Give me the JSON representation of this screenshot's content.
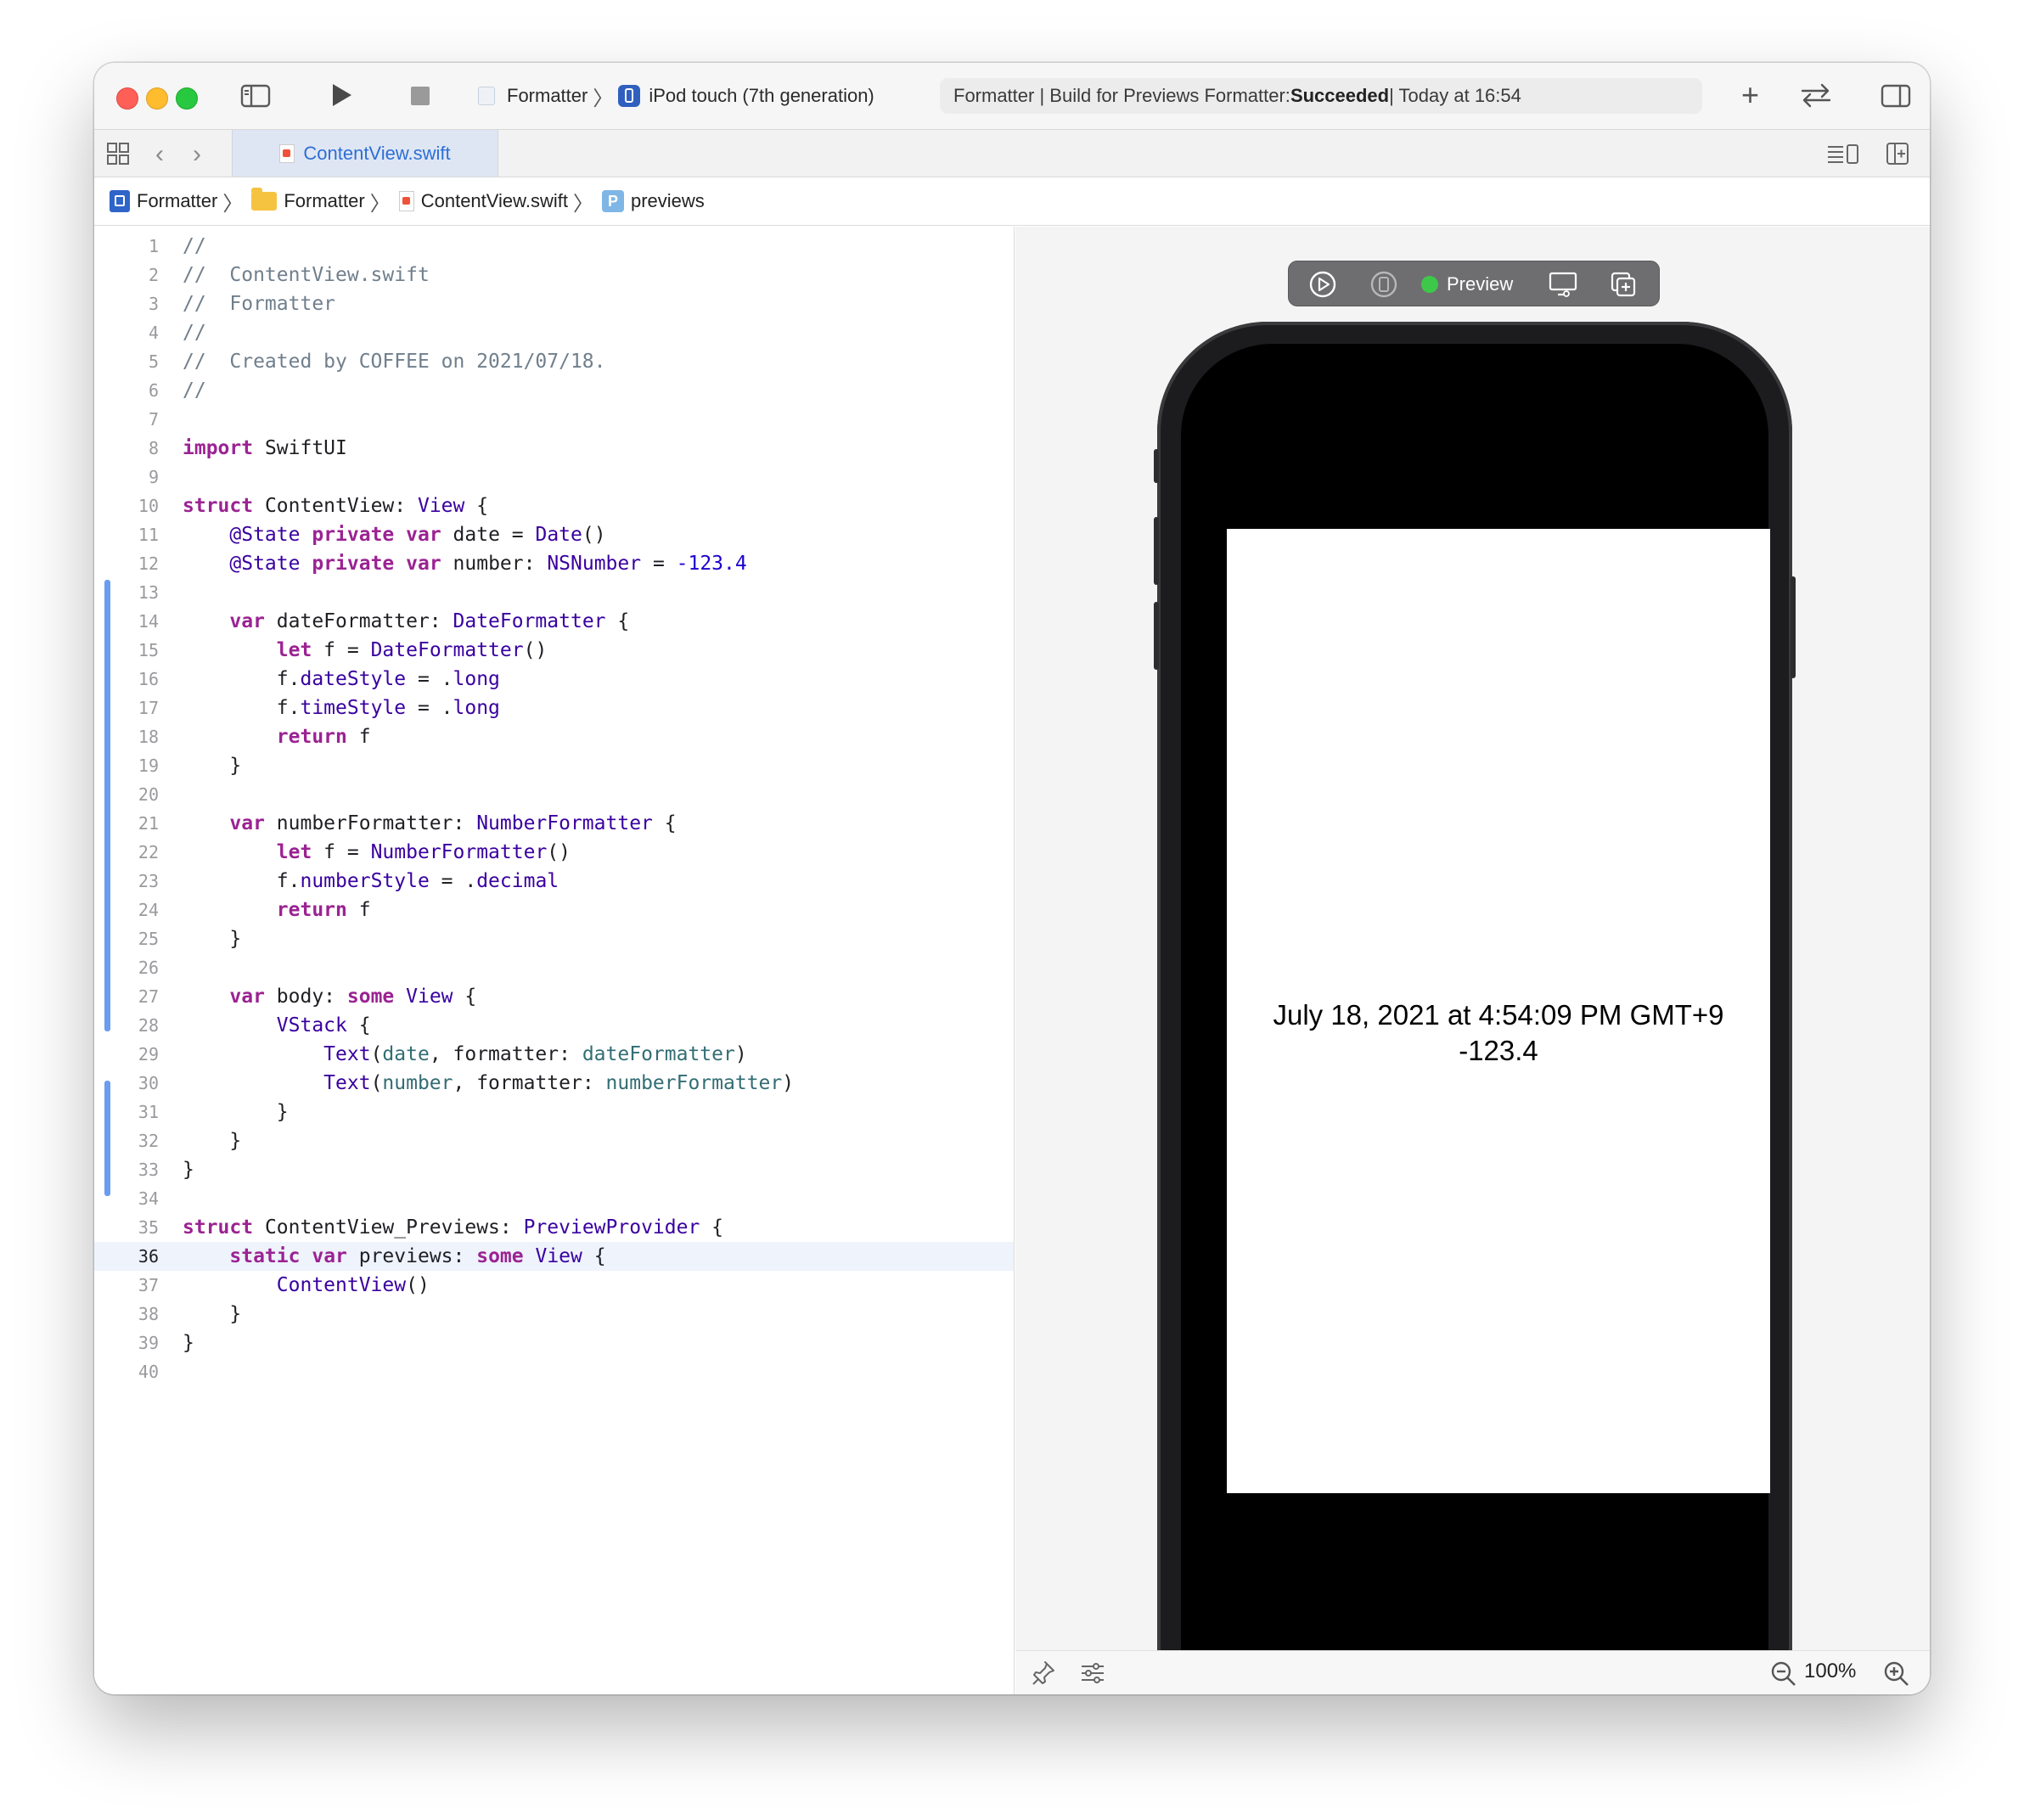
{
  "window": {
    "scheme": {
      "project": "Formatter",
      "destination": "iPod touch (7th generation)"
    },
    "status": {
      "prefix": "Formatter | Build for Previews Formatter: ",
      "result": "Succeeded",
      "suffix": " | Today at 16:54"
    }
  },
  "tabs": [
    {
      "label": "ContentView.swift",
      "active": true
    }
  ],
  "jumpbar": [
    {
      "label": "Formatter",
      "icon": "project-icon"
    },
    {
      "label": "Formatter",
      "icon": "folder-icon"
    },
    {
      "label": "ContentView.swift",
      "icon": "swift-file-icon"
    },
    {
      "label": "previews",
      "icon": "property-icon"
    }
  ],
  "editor": {
    "current_line": 36,
    "lines": [
      {
        "n": "1",
        "html": "<span class=\"c\">//</span>"
      },
      {
        "n": "2",
        "html": "<span class=\"c\">//  ContentView.swift</span>"
      },
      {
        "n": "3",
        "html": "<span class=\"c\">//  Formatter</span>"
      },
      {
        "n": "4",
        "html": "<span class=\"c\">//</span>"
      },
      {
        "n": "5",
        "html": "<span class=\"c\">//  Created by COFFEE on 2021/07/18.</span>"
      },
      {
        "n": "6",
        "html": "<span class=\"c\">//</span>"
      },
      {
        "n": "7",
        "html": ""
      },
      {
        "n": "8",
        "html": "<span class=\"k\">import</span> SwiftUI"
      },
      {
        "n": "9",
        "html": ""
      },
      {
        "n": "10",
        "html": "<span class=\"k\">struct</span> ContentView: <span class=\"t\">View</span> {"
      },
      {
        "n": "11",
        "html": "    <span class=\"t\">@State</span> <span class=\"k\">private</span> <span class=\"k\">var</span> date = <span class=\"t\">Date</span>()"
      },
      {
        "n": "12",
        "html": "    <span class=\"t\">@State</span> <span class=\"k\">private</span> <span class=\"k\">var</span> number: <span class=\"t\">NSNumber</span> = <span class=\"n\">-123.4</span>"
      },
      {
        "n": "13",
        "html": ""
      },
      {
        "n": "14",
        "html": "    <span class=\"k\">var</span> dateFormatter: <span class=\"t\">DateFormatter</span> {"
      },
      {
        "n": "15",
        "html": "        <span class=\"k\">let</span> f = <span class=\"t\">DateFormatter</span>()"
      },
      {
        "n": "16",
        "html": "        f.<span class=\"t\">dateStyle</span> = .<span class=\"t\">long</span>"
      },
      {
        "n": "17",
        "html": "        f.<span class=\"t\">timeStyle</span> = .<span class=\"t\">long</span>"
      },
      {
        "n": "18",
        "html": "        <span class=\"k\">return</span> f"
      },
      {
        "n": "19",
        "html": "    }"
      },
      {
        "n": "20",
        "html": ""
      },
      {
        "n": "21",
        "html": "    <span class=\"k\">var</span> numberFormatter: <span class=\"t\">NumberFormatter</span> {"
      },
      {
        "n": "22",
        "html": "        <span class=\"k\">let</span> f = <span class=\"t\">NumberFormatter</span>()"
      },
      {
        "n": "23",
        "html": "        f.<span class=\"t\">numberStyle</span> = .<span class=\"t\">decimal</span>"
      },
      {
        "n": "24",
        "html": "        <span class=\"k\">return</span> f"
      },
      {
        "n": "25",
        "html": "    }"
      },
      {
        "n": "26",
        "html": ""
      },
      {
        "n": "27",
        "html": "    <span class=\"k\">var</span> body: <span class=\"k\">some</span> <span class=\"t\">View</span> {"
      },
      {
        "n": "28",
        "html": "        <span class=\"t\">VStack</span> {"
      },
      {
        "n": "29",
        "html": "            <span class=\"t\">Text</span>(<span class=\"p\">date</span>, formatter: <span class=\"p\">dateFormatter</span>)"
      },
      {
        "n": "30",
        "html": "            <span class=\"t\">Text</span>(<span class=\"p\">number</span>, formatter: <span class=\"p\">numberFormatter</span>)"
      },
      {
        "n": "31",
        "html": "        }"
      },
      {
        "n": "32",
        "html": "    }"
      },
      {
        "n": "33",
        "html": "}"
      },
      {
        "n": "34",
        "html": ""
      },
      {
        "n": "35",
        "html": "<span class=\"k\">struct</span> ContentView_Previews: <span class=\"t\">PreviewProvider</span> {"
      },
      {
        "n": "36",
        "html": "    <span class=\"k\">static</span> <span class=\"k\">var</span> previews: <span class=\"k\">some</span> <span class=\"t\">View</span> {"
      },
      {
        "n": "37",
        "html": "        <span class=\"t\">ContentView</span>()"
      },
      {
        "n": "38",
        "html": "    }"
      },
      {
        "n": "39",
        "html": "}"
      },
      {
        "n": "40",
        "html": ""
      }
    ]
  },
  "preview": {
    "label": "Preview",
    "status_color": "#3ec84a",
    "screen_lines": [
      "July 18, 2021 at 4:54:09 PM GMT+9",
      "-123.4"
    ]
  },
  "canvas": {
    "zoom": "100%"
  },
  "colors": {
    "accent": "#2d6fd6",
    "close": "#fe5f57",
    "minimize": "#febc2e",
    "zoom": "#28c840"
  }
}
